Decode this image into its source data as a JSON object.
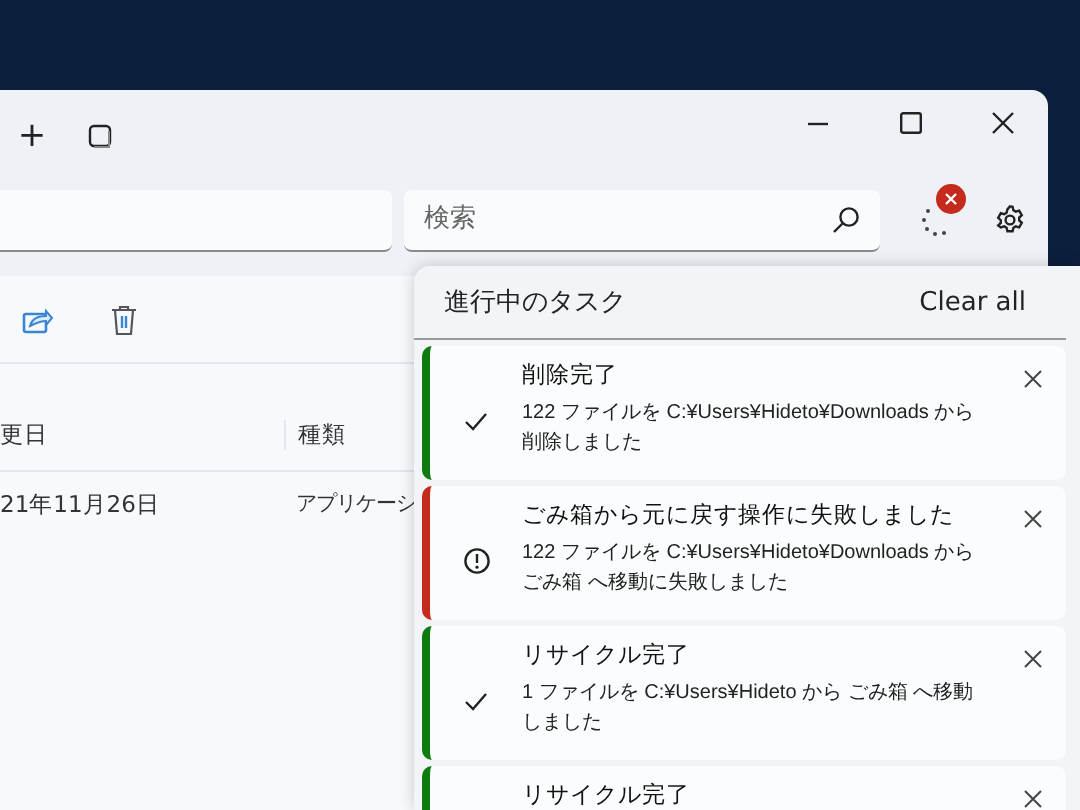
{
  "title_bar": {
    "new_tab": "+"
  },
  "toolbar": {
    "search": {
      "placeholder": "検索"
    }
  },
  "file_list": {
    "columns": [
      "更日",
      "種類"
    ],
    "rows": [
      [
        "21年11月26日",
        "アプリケーシ"
      ]
    ]
  },
  "task_panel": {
    "title": "進行中のタスク",
    "clear_all": "Clear all",
    "tasks": [
      {
        "kind": "success",
        "title": "削除完了",
        "message": "122 ファイルを C:¥Users¥Hideto¥Downloads から削除しました"
      },
      {
        "kind": "error",
        "title": "ごみ箱から元に戻す操作に失敗しました",
        "message": "122 ファイルを C:¥Users¥Hideto¥Downloads からごみ箱 へ移動に失敗しました"
      },
      {
        "kind": "success",
        "title": "リサイクル完了",
        "message": "1 ファイルを C:¥Users¥Hideto から ごみ箱 へ移動しました"
      },
      {
        "kind": "success",
        "title": "リサイクル完了"
      }
    ]
  }
}
